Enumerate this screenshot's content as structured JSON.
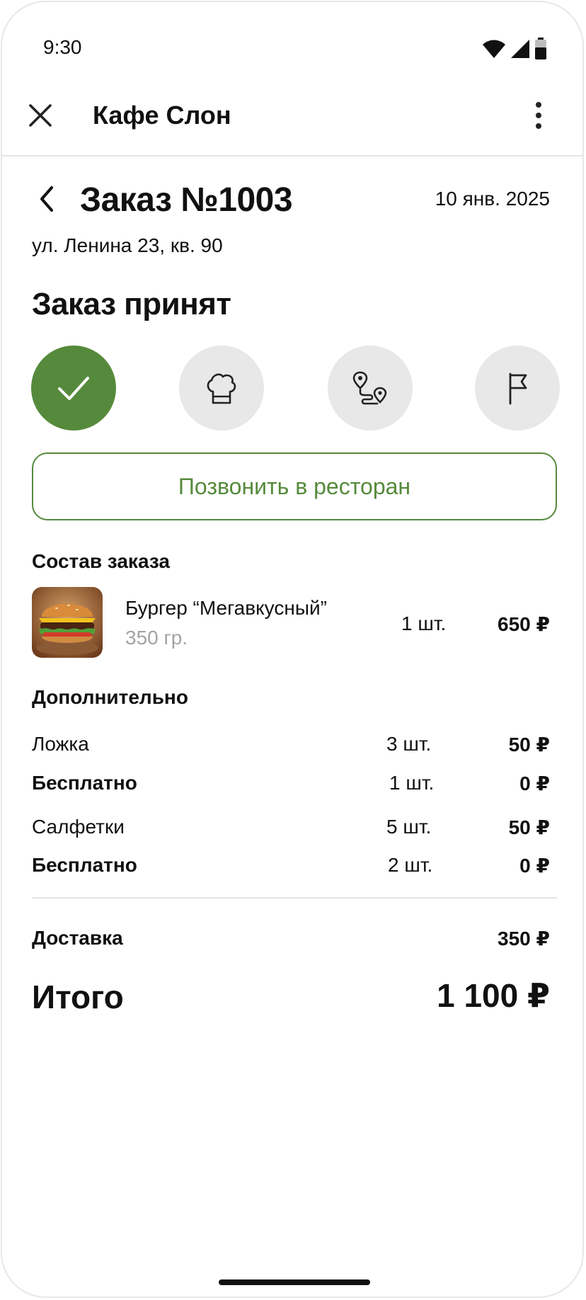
{
  "status_bar": {
    "time": "9:30"
  },
  "app_bar": {
    "title": "Кафе Слон",
    "close_icon": "close-icon",
    "more_icon": "more-vertical-icon"
  },
  "order": {
    "title": "Заказ №1003",
    "date": "10 янв. 2025",
    "address": "ул. Ленина 23, кв. 90",
    "status": "Заказ принят"
  },
  "steps": [
    {
      "icon": "check-icon",
      "state": "done"
    },
    {
      "icon": "chef-hat-icon",
      "state": "pending"
    },
    {
      "icon": "route-icon",
      "state": "pending"
    },
    {
      "icon": "flag-icon",
      "state": "pending"
    }
  ],
  "call_button": {
    "label": "Позвонить в ресторан"
  },
  "contents": {
    "title": "Состав заказа",
    "items": [
      {
        "name": "Бургер “Мегавкусный”",
        "weight": "350 гр.",
        "qty": "1 шт.",
        "price": "650 ₽"
      }
    ]
  },
  "extras": {
    "title": "Дополнительно",
    "rows": [
      {
        "label": "Ложка",
        "qty": "3 шт.",
        "price": "50 ₽"
      },
      {
        "label": "Бесплатно",
        "qty": "1 шт.",
        "price": "0 ₽"
      },
      {
        "label": "Салфетки",
        "qty": "5 шт.",
        "price": "50 ₽"
      },
      {
        "label": "Бесплатно",
        "qty": "2 шт.",
        "price": "0 ₽"
      }
    ]
  },
  "totals": {
    "delivery_label": "Доставка",
    "delivery_price": "350 ₽",
    "total_label": "Итого",
    "total_price": "1 100 ₽"
  },
  "colors": {
    "accent": "#558a3c",
    "step_inactive": "#e8e8e8",
    "muted_text": "#a3a3a3"
  }
}
